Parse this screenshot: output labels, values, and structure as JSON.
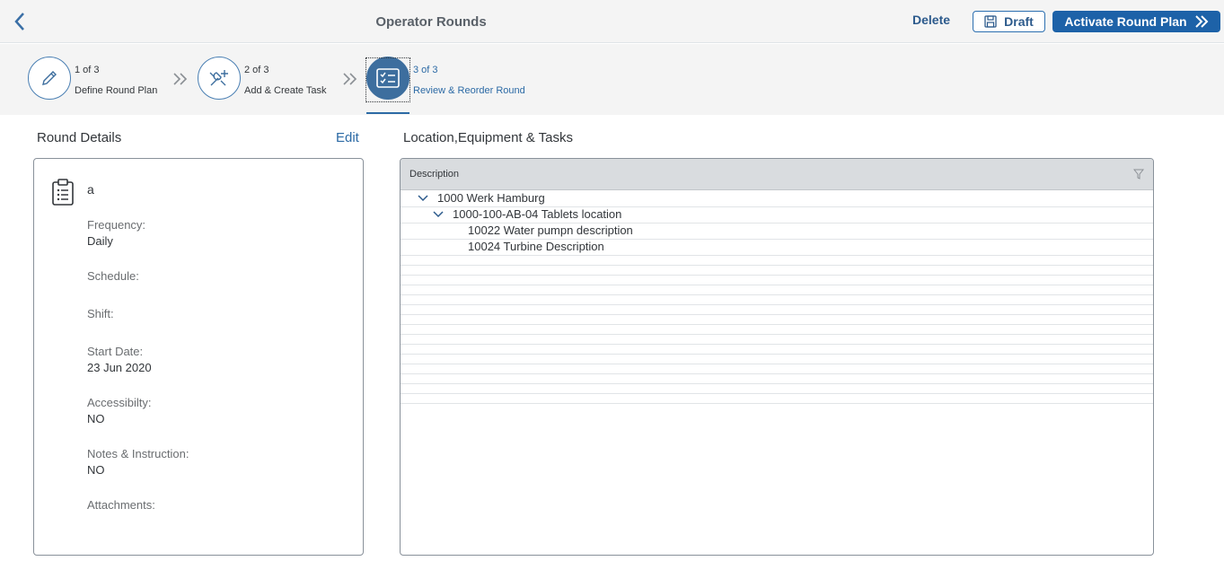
{
  "header": {
    "title": "Operator Rounds",
    "delete_label": "Delete",
    "draft_label": "Draft",
    "activate_label": "Activate Round Plan"
  },
  "wizard": {
    "steps": [
      {
        "count": "1 of 3",
        "label": "Define Round Plan",
        "icon": "pencil-icon",
        "active": false
      },
      {
        "count": "2 of 3",
        "label": "Add & Create Task",
        "icon": "wrench-add-icon",
        "active": false
      },
      {
        "count": "3 of 3",
        "label": "Review & Reorder Round",
        "icon": "checklist-icon",
        "active": true
      }
    ]
  },
  "round_details": {
    "title": "Round Details",
    "edit_label": "Edit",
    "icon": "clipboard-list-icon",
    "name": "a",
    "fields": [
      {
        "label": "Frequency:",
        "value": "Daily"
      },
      {
        "label": "Schedule:",
        "value": ""
      },
      {
        "label": "Shift:",
        "value": ""
      },
      {
        "label": "Start Date:",
        "value": "23 Jun 2020"
      },
      {
        "label": "Accessibilty:",
        "value": "NO"
      },
      {
        "label": "Notes & Instruction:",
        "value": "NO"
      },
      {
        "label": "Attachments:",
        "value": ""
      }
    ]
  },
  "location_table": {
    "title": "Location,Equipment & Tasks",
    "column_header": "Description",
    "rows": [
      {
        "text": "1000 Werk Hamburg",
        "level": 0,
        "expanded": true
      },
      {
        "text": "1000-100-AB-04 Tablets location",
        "level": 1,
        "expanded": true
      },
      {
        "text": "10022 Water pumpn description",
        "level": 2
      },
      {
        "text": "10024 Turbine Description",
        "level": 2
      }
    ]
  },
  "colors": {
    "accent": "#1d62a8",
    "link": "#2c6aa5",
    "header_bg": "#f4f4f4",
    "table_header_bg": "#d9dcdf"
  }
}
